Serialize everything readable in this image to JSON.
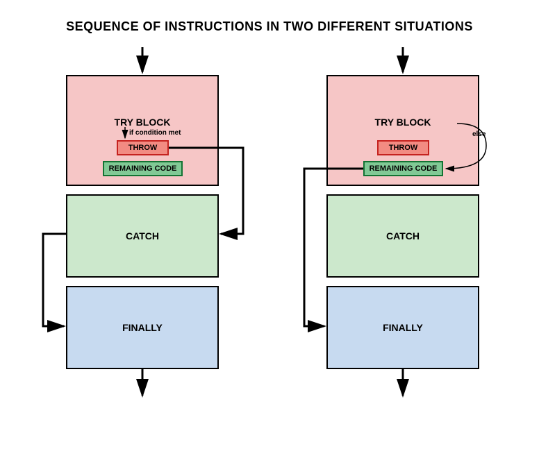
{
  "title": "SEQUENCE OF INSTRUCTIONS IN TWO DIFFERENT SITUATIONS",
  "left": {
    "try_label": "TRY BLOCK",
    "cond_label": "if condition met",
    "throw_label": "THROW",
    "remain_label": "REMAINING CODE",
    "catch_label": "CATCH",
    "finally_label": "FINALLY"
  },
  "right": {
    "try_label": "TRY BLOCK",
    "else_label": "else",
    "throw_label": "THROW",
    "remain_label": "REMAINING CODE",
    "catch_label": "CATCH",
    "finally_label": "FINALLY"
  }
}
